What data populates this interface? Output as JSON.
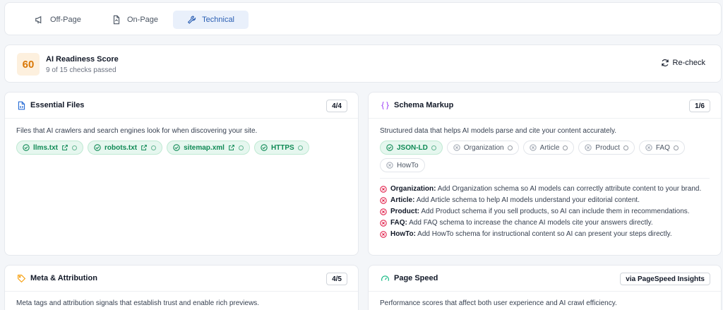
{
  "tabs": [
    {
      "label": "Off-Page",
      "icon": "megaphone-icon",
      "active": false
    },
    {
      "label": "On-Page",
      "icon": "file-icon",
      "active": false
    },
    {
      "label": "Technical",
      "icon": "wrench-icon",
      "active": true
    }
  ],
  "score": {
    "value": "60",
    "title": "AI Readiness Score",
    "subtitle": "9 of 15 checks passed",
    "recheck_label": "Re-check"
  },
  "essential": {
    "title": "Essential Files",
    "count": "4/4",
    "description": "Files that AI crawlers and search engines look for when discovering your site.",
    "chips": [
      "llms.txt",
      "robots.txt",
      "sitemap.xml",
      "HTTPS"
    ]
  },
  "schema": {
    "title": "Schema Markup",
    "count": "1/6",
    "description": "Structured data that helps AI models parse and cite your content accurately.",
    "chips": [
      {
        "label": "JSON-LD",
        "status": "ok"
      },
      {
        "label": "Organization",
        "status": "bad"
      },
      {
        "label": "Article",
        "status": "bad"
      },
      {
        "label": "Product",
        "status": "bad"
      },
      {
        "label": "FAQ",
        "status": "bad"
      },
      {
        "label": "HowTo",
        "status": "bad"
      }
    ],
    "issues": [
      {
        "name": "Organization:",
        "text": "Add Organization schema so AI models can correctly attribute content to your brand."
      },
      {
        "name": "Article:",
        "text": "Add Article schema to help AI models understand your editorial content."
      },
      {
        "name": "Product:",
        "text": "Add Product schema if you sell products, so AI can include them in recommendations."
      },
      {
        "name": "FAQ:",
        "text": "Add FAQ schema to increase the chance AI models cite your answers directly."
      },
      {
        "name": "HowTo:",
        "text": "Add HowTo schema for instructional content so AI can present your steps directly."
      }
    ]
  },
  "meta": {
    "title": "Meta & Attribution",
    "count": "4/5",
    "description": "Meta tags and attribution signals that establish trust and enable rich previews."
  },
  "speed": {
    "title": "Page Speed",
    "badge": "via PageSpeed Insights",
    "description": "Performance scores that affect both user experience and AI crawl efficiency."
  },
  "colors": {
    "ok": "#0f8a55",
    "bad": "#e11d48",
    "accent": "#2b5fb3",
    "score": "#d97706"
  }
}
